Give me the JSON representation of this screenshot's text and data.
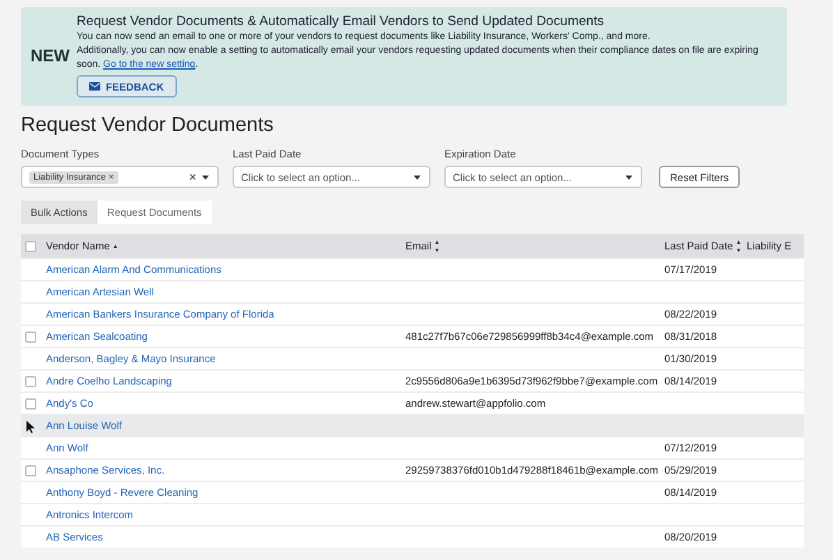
{
  "banner": {
    "badge": "NEW",
    "title": "Request Vendor Documents & Automatically Email Vendors to Send Updated Documents",
    "body": "You can now send an email to one or more of your vendors to request documents like Liability Insurance, Workers' Comp., and more.",
    "body_2": {
      "text": "Additionally, you can now enable a setting to automatically email your vendors requesting updated documents when their compliance dates on file are expiring soon.",
      "link": "Go to the new setting",
      "after": "."
    },
    "button": "FEEDBACK"
  },
  "heading": "Request Vendor Documents",
  "filters": [
    {
      "kind": "multi",
      "label": "Document Types",
      "tags": [
        {
          "label": "Liability Insurance",
          "remove_icon": "×"
        }
      ],
      "clear_icon": "×"
    },
    {
      "kind": "select",
      "label": "Last Paid Date",
      "placeholder": "Click to select an option..."
    },
    {
      "kind": "select",
      "label": "Expiration Date",
      "placeholder": "Click to select an option..."
    }
  ],
  "reset_button": "Reset Filters",
  "tabs": [
    {
      "label": "Bulk Actions",
      "selected": false
    },
    {
      "label": "Request Documents",
      "selected": true
    }
  ],
  "table": {
    "select_all": {
      "checked": false
    },
    "columns": [
      {
        "label": "Vendor Name",
        "sort": [
          "▲"
        ]
      },
      {
        "label": "Email",
        "sort": [
          "▲",
          "▼"
        ]
      },
      {
        "label": "Last Paid Date",
        "sort": [
          "▲",
          "▼"
        ]
      },
      {
        "label": "Liability E"
      }
    ],
    "rows": [
      {
        "hovered": false,
        "vendor": "American Alarm And Communications",
        "last_paid": "07/17/2019"
      },
      {
        "hovered": false,
        "vendor": "American Artesian Well"
      },
      {
        "hovered": false,
        "vendor": "American Bankers Insurance Company of Florida",
        "last_paid": "08/22/2019"
      },
      {
        "checkbox": {
          "checked": false
        },
        "hovered": false,
        "vendor": "American Sealcoating",
        "email": "481c27f7b67c06e729856999ff8b34c4@example.com",
        "last_paid": "08/31/2018"
      },
      {
        "hovered": false,
        "vendor": "Anderson, Bagley & Mayo Insurance",
        "last_paid": "01/30/2019"
      },
      {
        "checkbox": {
          "checked": false
        },
        "hovered": false,
        "vendor": "Andre Coelho Landscaping",
        "email": "2c9556d806a9e1b6395d73f962f9bbe7@example.com",
        "last_paid": "08/14/2019"
      },
      {
        "checkbox": {
          "checked": false
        },
        "hovered": false,
        "vendor": "Andy's Co",
        "email": "andrew.stewart@appfolio.com"
      },
      {
        "hovered": true,
        "vendor": "Ann Louise Wolf"
      },
      {
        "hovered": false,
        "vendor": "Ann Wolf",
        "last_paid": "07/12/2019"
      },
      {
        "checkbox": {
          "checked": false
        },
        "hovered": false,
        "vendor": "Ansaphone Services, Inc.",
        "email": "29259738376fd010b1d479288f18461b@example.com",
        "last_paid": "05/29/2019"
      },
      {
        "hovered": false,
        "vendor": "Anthony Boyd - Revere Cleaning",
        "last_paid": "08/14/2019"
      },
      {
        "hovered": false,
        "vendor": "Antronics Intercom"
      },
      {
        "hovered": false,
        "vendor": "AB Services",
        "last_paid": "08/20/2019"
      }
    ]
  }
}
